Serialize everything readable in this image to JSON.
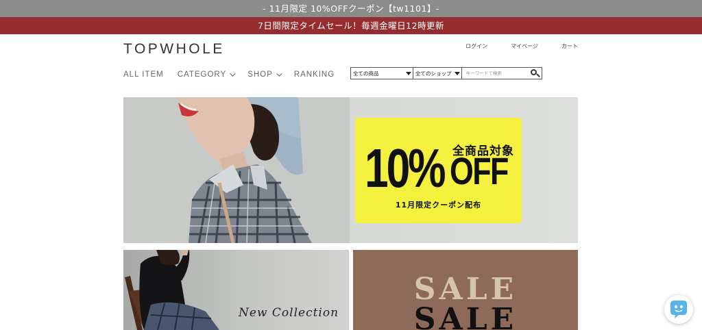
{
  "announcements": {
    "coupon": "- 11月限定 10%OFFクーポン【tw1101】-",
    "sale": "7日間限定タイムセール！毎週金曜日12時更新"
  },
  "header": {
    "logo": "TOPWHOLE",
    "user_nav": {
      "login": "ログイン",
      "mypage": "マイページ",
      "cart": "カート"
    }
  },
  "main_nav": {
    "all_item": "ALL ITEM",
    "category": "CATEGORY",
    "shop": "SHOP",
    "ranking": "RANKING"
  },
  "search": {
    "category_select": "全ての商品",
    "shop_select": "全てのショップ",
    "placeholder": "キーワードで検索",
    "icon": "search-icon"
  },
  "hero": {
    "discount": "10%",
    "scope": "全商品対象",
    "off": "OFF",
    "subtitle": "11月限定クーポン配布",
    "promo_color": "#f4f03e"
  },
  "cards": {
    "new_collection": "New Collection",
    "sale_1": "SALE",
    "sale_2": "SALE"
  },
  "colors": {
    "top_bar": "#8c8c8c",
    "sale_bar": "#952d2f",
    "chat_icon": "#57b4e8"
  },
  "chat": {
    "icon": "chat-bot-icon"
  }
}
